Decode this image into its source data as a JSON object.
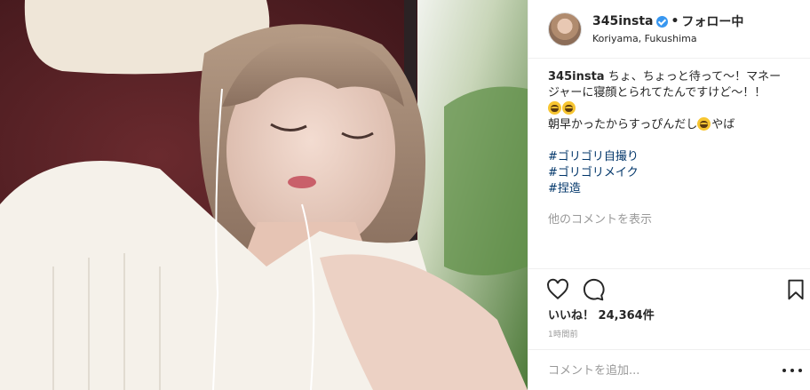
{
  "post": {
    "username": "345insta",
    "dot": "•",
    "follow_label": "フォロー中",
    "location": "Koriyama, Fukushima"
  },
  "caption": {
    "user": "345insta",
    "line1": "ちょ、ちょっと待って〜！マネー",
    "line2": "ジャーに寝顔とられてたんですけど〜！！",
    "line4_text": "朝早かったからすっぴんだし",
    "line4_tail": "やば",
    "hashtags": [
      "#ゴリゴリ自撮り",
      "#ゴリゴリメイク",
      "#捏造"
    ]
  },
  "more_comments": "他のコメントを表示",
  "likes": {
    "label": "いいね！",
    "count": "24,364件"
  },
  "timestamp": "1時間前",
  "comment": {
    "placeholder": "コメントを追加..."
  },
  "icons": {
    "verified": "verified-badge-icon",
    "like": "heart-icon",
    "comment": "comment-bubble-icon",
    "save": "bookmark-icon",
    "options": "more-options-icon",
    "emoji": "laughing-emoji-icon"
  },
  "colors": {
    "verified": "#3897f0",
    "hashtag": "#003569",
    "muted": "#999999",
    "text": "#262626"
  }
}
